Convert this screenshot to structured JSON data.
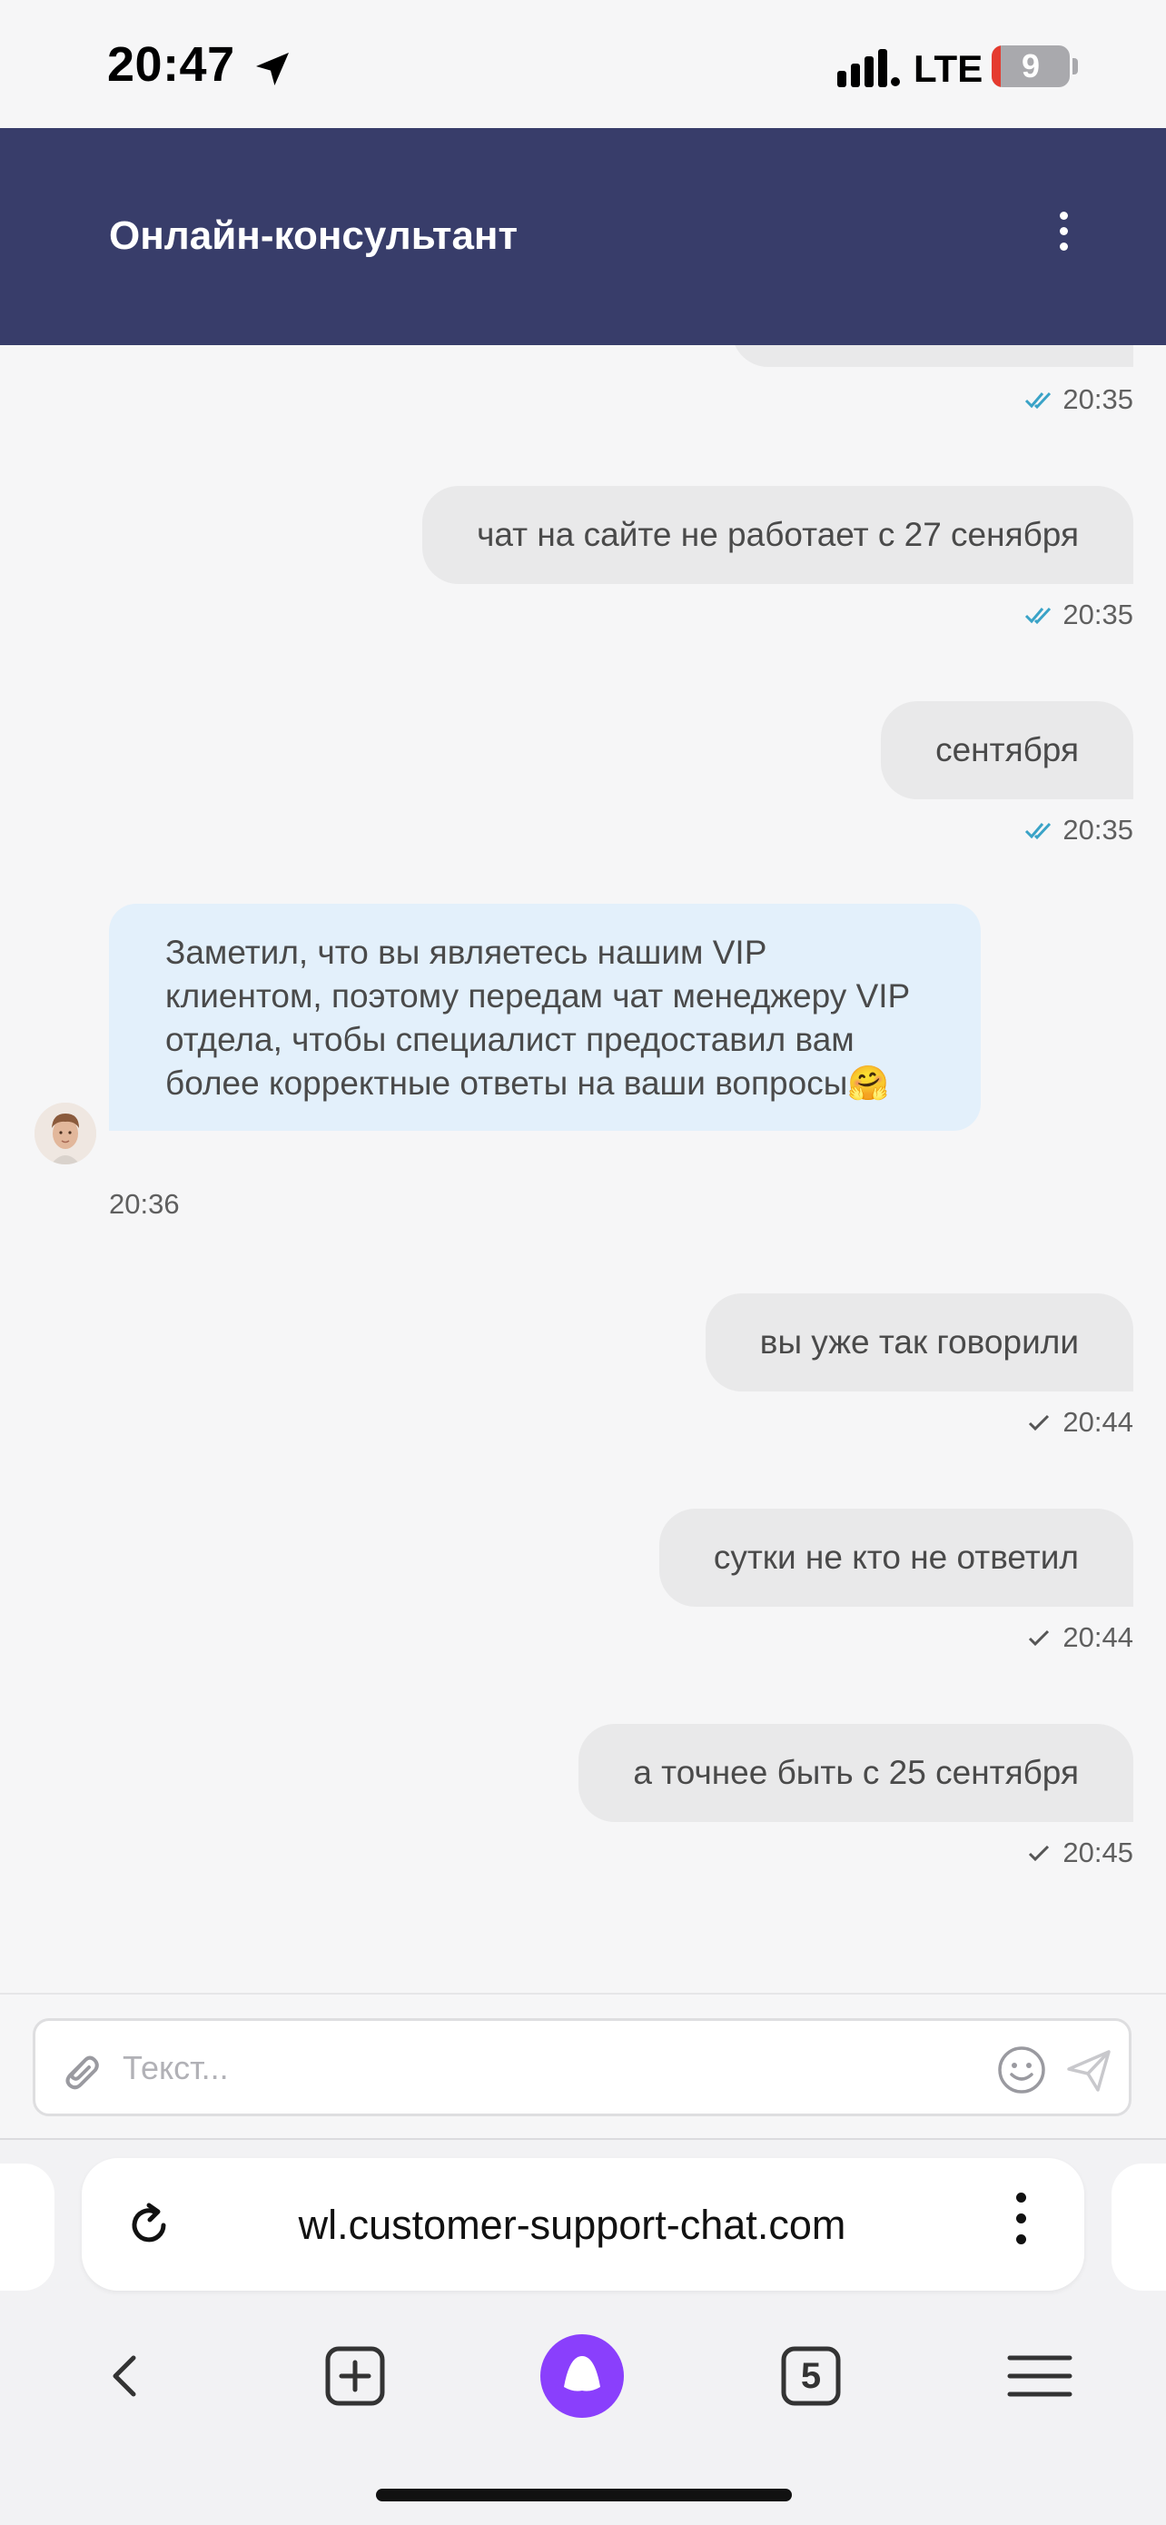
{
  "status_bar": {
    "time": "20:47",
    "network": "LTE",
    "battery": "9",
    "icons": [
      "location-arrow-icon",
      "cellular-signal-icon",
      "battery-icon"
    ]
  },
  "header": {
    "title": "Онлайн-консультант",
    "menu_icon": "more-vertical-icon"
  },
  "messages": [
    {
      "direction": "outgoing",
      "text": "",
      "time": "20:35",
      "status": "read"
    },
    {
      "direction": "outgoing",
      "text": "чат на сайте не работает с 27 сенября",
      "time": "20:35",
      "status": "read"
    },
    {
      "direction": "outgoing",
      "text": "сентября",
      "time": "20:35",
      "status": "read"
    },
    {
      "direction": "incoming",
      "text": "Заметил, что вы являетесь нашим VIP клиентом, поэтому передам чат менеджеру VIP отдела, чтобы специалист предоставил вам более корректные ответы на ваши вопросы🤗",
      "time": "20:36"
    },
    {
      "direction": "outgoing",
      "text": "вы уже так говорили",
      "time": "20:44",
      "status": "sent"
    },
    {
      "direction": "outgoing",
      "text": "сутки не кто не ответил",
      "time": "20:44",
      "status": "sent"
    },
    {
      "direction": "outgoing",
      "text": "а точнее быть с 25 сентября",
      "time": "20:45",
      "status": "sent"
    }
  ],
  "composer": {
    "placeholder": "Текст...",
    "value": "",
    "icons": [
      "paperclip-icon",
      "emoji-icon",
      "send-icon"
    ]
  },
  "browser": {
    "url": "wl.customer-support-chat.com",
    "tabs_count": "5",
    "icons": [
      "reload-icon",
      "more-vertical-icon",
      "back-icon",
      "new-tab-icon",
      "alice-icon",
      "tabs-icon",
      "menu-icon"
    ]
  },
  "colors": {
    "header_bg": "#383d6a",
    "outgoing_bubble": "#e9e9ea",
    "incoming_bubble": "#e3f0fb",
    "read_check": "#3aa3c7",
    "alice_purple": "#8a3ffc"
  }
}
